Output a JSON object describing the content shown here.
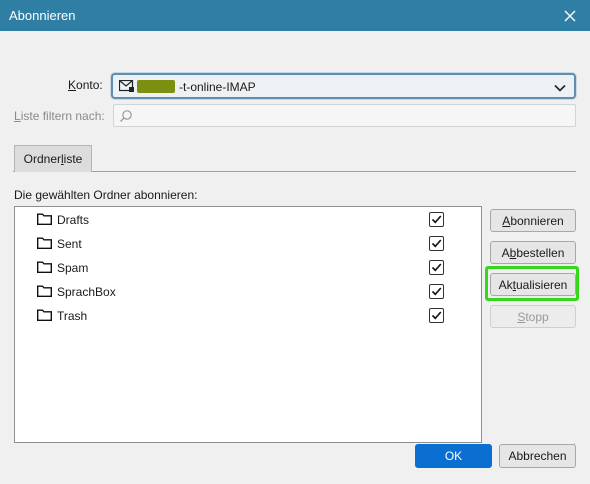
{
  "window": {
    "title": "Abonnieren"
  },
  "konto": {
    "label_pre": "",
    "label_ul": "K",
    "label_post": "onto:",
    "value": "-t-online-IMAP"
  },
  "filter": {
    "label_ul": "L",
    "label_post": "iste filtern nach:",
    "placeholder": ""
  },
  "tab": {
    "label_pre": "Ordner",
    "label_ul": "l",
    "label_post": "iste"
  },
  "section_label": "Die gewählten Ordner abonnieren:",
  "folders": [
    {
      "name": "Drafts",
      "checked": true
    },
    {
      "name": "Sent",
      "checked": true
    },
    {
      "name": "Spam",
      "checked": true
    },
    {
      "name": "SprachBox",
      "checked": true
    },
    {
      "name": "Trash",
      "checked": true
    }
  ],
  "buttons": {
    "subscribe": {
      "pre": "",
      "ul": "A",
      "post": "bonnieren"
    },
    "unsubscribe": {
      "pre": "A",
      "ul": "b",
      "post": "bestellen"
    },
    "refresh": {
      "pre": "Ak",
      "ul": "t",
      "post": "ualisieren"
    },
    "stop": {
      "pre": "",
      "ul": "S",
      "post": "topp"
    },
    "ok": "OK",
    "cancel": "Abbrechen"
  },
  "colors": {
    "titlebar": "#2f7fa4",
    "highlight": "#36d81b",
    "ok": "#0a6fd0"
  }
}
